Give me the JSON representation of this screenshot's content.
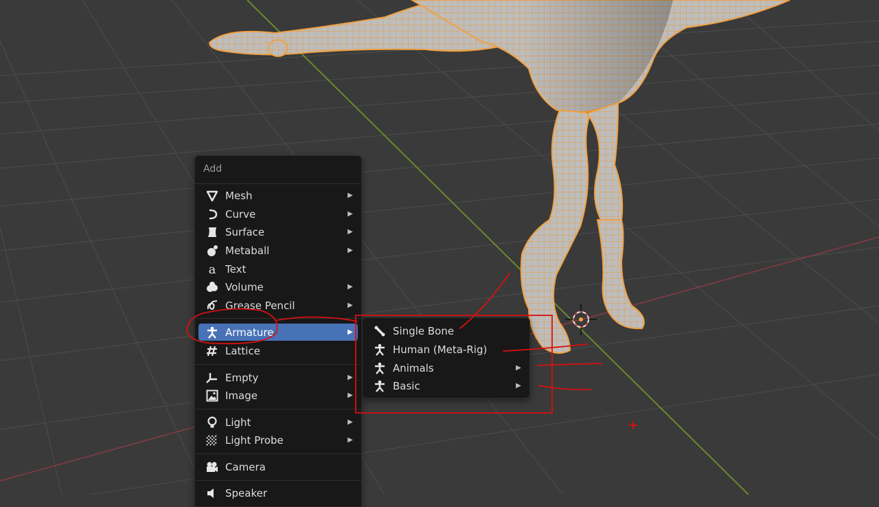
{
  "add_menu": {
    "title": "Add",
    "groups": [
      [
        {
          "label": "Mesh",
          "icon": "mesh-icon",
          "submenu": true
        },
        {
          "label": "Curve",
          "icon": "curve-icon",
          "submenu": true
        },
        {
          "label": "Surface",
          "icon": "surface-icon",
          "submenu": true
        },
        {
          "label": "Metaball",
          "icon": "metaball-icon",
          "submenu": true
        },
        {
          "label": "Text",
          "icon": "text-icon",
          "submenu": false
        },
        {
          "label": "Volume",
          "icon": "volume-icon",
          "submenu": true
        },
        {
          "label": "Grease Pencil",
          "icon": "grease-pencil-icon",
          "submenu": true
        }
      ],
      [
        {
          "label": "Armature",
          "icon": "armature-icon",
          "submenu": true,
          "active": true
        },
        {
          "label": "Lattice",
          "icon": "lattice-icon",
          "submenu": false
        }
      ],
      [
        {
          "label": "Empty",
          "icon": "empty-icon",
          "submenu": true
        },
        {
          "label": "Image",
          "icon": "image-icon",
          "submenu": true
        }
      ],
      [
        {
          "label": "Light",
          "icon": "light-icon",
          "submenu": true
        },
        {
          "label": "Light Probe",
          "icon": "light-probe-icon",
          "submenu": true
        }
      ],
      [
        {
          "label": "Camera",
          "icon": "camera-icon",
          "submenu": false
        }
      ],
      [
        {
          "label": "Speaker",
          "icon": "speaker-icon",
          "submenu": false
        }
      ]
    ]
  },
  "armature_submenu": {
    "items": [
      {
        "label": "Single Bone",
        "icon": "bone-icon",
        "submenu": false
      },
      {
        "label": "Human (Meta-Rig)",
        "icon": "armature-icon",
        "submenu": false
      },
      {
        "label": "Animals",
        "icon": "armature-icon",
        "submenu": true
      },
      {
        "label": "Basic",
        "icon": "armature-icon",
        "submenu": true
      }
    ]
  },
  "submenu_arrow": "▶",
  "colors": {
    "viewport_bg": "#3a3a3a",
    "grid": "#4a4a4a",
    "x_axis": "#8a3a44",
    "y_axis": "#6a8a2a",
    "mesh_wire": "#f0a040",
    "mesh_fill": "#b4b4b4",
    "menu_bg": "#181818",
    "active_item": "#4872b6",
    "annotation": "#d81010"
  }
}
